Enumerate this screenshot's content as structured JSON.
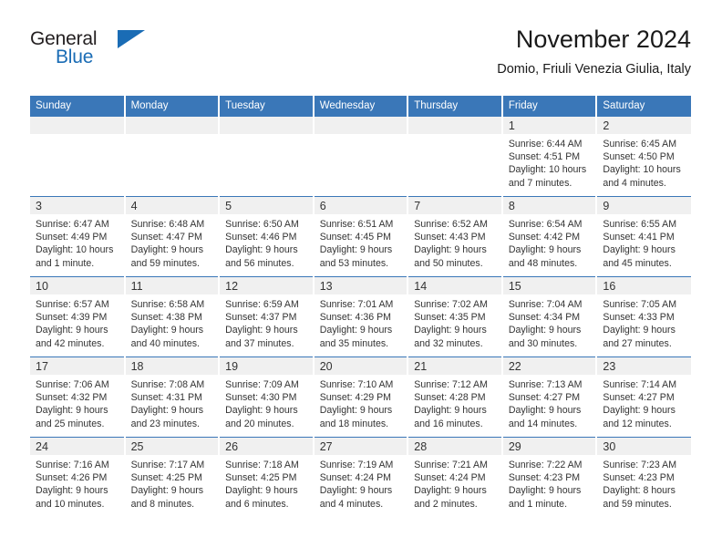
{
  "brand": {
    "name_part1": "General",
    "name_part2": "Blue",
    "triangle_icon": "triangle-icon",
    "accent_color": "#1a6cb5"
  },
  "header": {
    "title": "November 2024",
    "subtitle": "Domio, Friuli Venezia Giulia, Italy"
  },
  "colors": {
    "header_blue": "#3a77b8",
    "daynum_band": "#f0f0f0",
    "text": "#333333"
  },
  "weekday_headers": [
    "Sunday",
    "Monday",
    "Tuesday",
    "Wednesday",
    "Thursday",
    "Friday",
    "Saturday"
  ],
  "labels": {
    "sunrise_prefix": "Sunrise:",
    "sunset_prefix": "Sunset:",
    "daylight_prefix": "Daylight:"
  },
  "weeks": [
    [
      {
        "day": "",
        "empty": true
      },
      {
        "day": "",
        "empty": true
      },
      {
        "day": "",
        "empty": true
      },
      {
        "day": "",
        "empty": true
      },
      {
        "day": "",
        "empty": true
      },
      {
        "day": "1",
        "sunrise": "Sunrise: 6:44 AM",
        "sunset": "Sunset: 4:51 PM",
        "daylight_line1": "Daylight: 10 hours",
        "daylight_line2": "and 7 minutes."
      },
      {
        "day": "2",
        "sunrise": "Sunrise: 6:45 AM",
        "sunset": "Sunset: 4:50 PM",
        "daylight_line1": "Daylight: 10 hours",
        "daylight_line2": "and 4 minutes."
      }
    ],
    [
      {
        "day": "3",
        "sunrise": "Sunrise: 6:47 AM",
        "sunset": "Sunset: 4:49 PM",
        "daylight_line1": "Daylight: 10 hours",
        "daylight_line2": "and 1 minute."
      },
      {
        "day": "4",
        "sunrise": "Sunrise: 6:48 AM",
        "sunset": "Sunset: 4:47 PM",
        "daylight_line1": "Daylight: 9 hours",
        "daylight_line2": "and 59 minutes."
      },
      {
        "day": "5",
        "sunrise": "Sunrise: 6:50 AM",
        "sunset": "Sunset: 4:46 PM",
        "daylight_line1": "Daylight: 9 hours",
        "daylight_line2": "and 56 minutes."
      },
      {
        "day": "6",
        "sunrise": "Sunrise: 6:51 AM",
        "sunset": "Sunset: 4:45 PM",
        "daylight_line1": "Daylight: 9 hours",
        "daylight_line2": "and 53 minutes."
      },
      {
        "day": "7",
        "sunrise": "Sunrise: 6:52 AM",
        "sunset": "Sunset: 4:43 PM",
        "daylight_line1": "Daylight: 9 hours",
        "daylight_line2": "and 50 minutes."
      },
      {
        "day": "8",
        "sunrise": "Sunrise: 6:54 AM",
        "sunset": "Sunset: 4:42 PM",
        "daylight_line1": "Daylight: 9 hours",
        "daylight_line2": "and 48 minutes."
      },
      {
        "day": "9",
        "sunrise": "Sunrise: 6:55 AM",
        "sunset": "Sunset: 4:41 PM",
        "daylight_line1": "Daylight: 9 hours",
        "daylight_line2": "and 45 minutes."
      }
    ],
    [
      {
        "day": "10",
        "sunrise": "Sunrise: 6:57 AM",
        "sunset": "Sunset: 4:39 PM",
        "daylight_line1": "Daylight: 9 hours",
        "daylight_line2": "and 42 minutes."
      },
      {
        "day": "11",
        "sunrise": "Sunrise: 6:58 AM",
        "sunset": "Sunset: 4:38 PM",
        "daylight_line1": "Daylight: 9 hours",
        "daylight_line2": "and 40 minutes."
      },
      {
        "day": "12",
        "sunrise": "Sunrise: 6:59 AM",
        "sunset": "Sunset: 4:37 PM",
        "daylight_line1": "Daylight: 9 hours",
        "daylight_line2": "and 37 minutes."
      },
      {
        "day": "13",
        "sunrise": "Sunrise: 7:01 AM",
        "sunset": "Sunset: 4:36 PM",
        "daylight_line1": "Daylight: 9 hours",
        "daylight_line2": "and 35 minutes."
      },
      {
        "day": "14",
        "sunrise": "Sunrise: 7:02 AM",
        "sunset": "Sunset: 4:35 PM",
        "daylight_line1": "Daylight: 9 hours",
        "daylight_line2": "and 32 minutes."
      },
      {
        "day": "15",
        "sunrise": "Sunrise: 7:04 AM",
        "sunset": "Sunset: 4:34 PM",
        "daylight_line1": "Daylight: 9 hours",
        "daylight_line2": "and 30 minutes."
      },
      {
        "day": "16",
        "sunrise": "Sunrise: 7:05 AM",
        "sunset": "Sunset: 4:33 PM",
        "daylight_line1": "Daylight: 9 hours",
        "daylight_line2": "and 27 minutes."
      }
    ],
    [
      {
        "day": "17",
        "sunrise": "Sunrise: 7:06 AM",
        "sunset": "Sunset: 4:32 PM",
        "daylight_line1": "Daylight: 9 hours",
        "daylight_line2": "and 25 minutes."
      },
      {
        "day": "18",
        "sunrise": "Sunrise: 7:08 AM",
        "sunset": "Sunset: 4:31 PM",
        "daylight_line1": "Daylight: 9 hours",
        "daylight_line2": "and 23 minutes."
      },
      {
        "day": "19",
        "sunrise": "Sunrise: 7:09 AM",
        "sunset": "Sunset: 4:30 PM",
        "daylight_line1": "Daylight: 9 hours",
        "daylight_line2": "and 20 minutes."
      },
      {
        "day": "20",
        "sunrise": "Sunrise: 7:10 AM",
        "sunset": "Sunset: 4:29 PM",
        "daylight_line1": "Daylight: 9 hours",
        "daylight_line2": "and 18 minutes."
      },
      {
        "day": "21",
        "sunrise": "Sunrise: 7:12 AM",
        "sunset": "Sunset: 4:28 PM",
        "daylight_line1": "Daylight: 9 hours",
        "daylight_line2": "and 16 minutes."
      },
      {
        "day": "22",
        "sunrise": "Sunrise: 7:13 AM",
        "sunset": "Sunset: 4:27 PM",
        "daylight_line1": "Daylight: 9 hours",
        "daylight_line2": "and 14 minutes."
      },
      {
        "day": "23",
        "sunrise": "Sunrise: 7:14 AM",
        "sunset": "Sunset: 4:27 PM",
        "daylight_line1": "Daylight: 9 hours",
        "daylight_line2": "and 12 minutes."
      }
    ],
    [
      {
        "day": "24",
        "sunrise": "Sunrise: 7:16 AM",
        "sunset": "Sunset: 4:26 PM",
        "daylight_line1": "Daylight: 9 hours",
        "daylight_line2": "and 10 minutes."
      },
      {
        "day": "25",
        "sunrise": "Sunrise: 7:17 AM",
        "sunset": "Sunset: 4:25 PM",
        "daylight_line1": "Daylight: 9 hours",
        "daylight_line2": "and 8 minutes."
      },
      {
        "day": "26",
        "sunrise": "Sunrise: 7:18 AM",
        "sunset": "Sunset: 4:25 PM",
        "daylight_line1": "Daylight: 9 hours",
        "daylight_line2": "and 6 minutes."
      },
      {
        "day": "27",
        "sunrise": "Sunrise: 7:19 AM",
        "sunset": "Sunset: 4:24 PM",
        "daylight_line1": "Daylight: 9 hours",
        "daylight_line2": "and 4 minutes."
      },
      {
        "day": "28",
        "sunrise": "Sunrise: 7:21 AM",
        "sunset": "Sunset: 4:24 PM",
        "daylight_line1": "Daylight: 9 hours",
        "daylight_line2": "and 2 minutes."
      },
      {
        "day": "29",
        "sunrise": "Sunrise: 7:22 AM",
        "sunset": "Sunset: 4:23 PM",
        "daylight_line1": "Daylight: 9 hours",
        "daylight_line2": "and 1 minute."
      },
      {
        "day": "30",
        "sunrise": "Sunrise: 7:23 AM",
        "sunset": "Sunset: 4:23 PM",
        "daylight_line1": "Daylight: 8 hours",
        "daylight_line2": "and 59 minutes."
      }
    ]
  ]
}
